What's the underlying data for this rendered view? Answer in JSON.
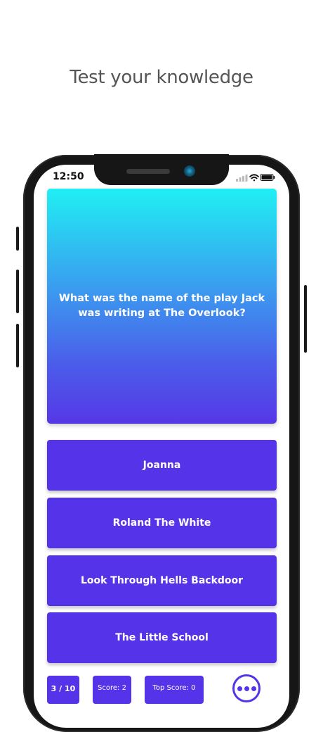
{
  "header": {
    "title": "Test your knowledge"
  },
  "status_bar": {
    "time": "12:50"
  },
  "quiz": {
    "question": "What was the name of the play Jack was writing at The Overlook?",
    "answers": [
      "Joanna",
      "Roland The White",
      "Look Through Hells Backdoor",
      "The Little School"
    ]
  },
  "footer": {
    "progress": "3 / 10",
    "score": "Score: 2",
    "top_score": "Top Score: 0",
    "menu_icon": "more-dots-icon"
  },
  "colors": {
    "accent": "#5533e8",
    "gradient_top": "#20eff3",
    "gradient_bottom": "#5637e6",
    "headline": "#555555"
  }
}
